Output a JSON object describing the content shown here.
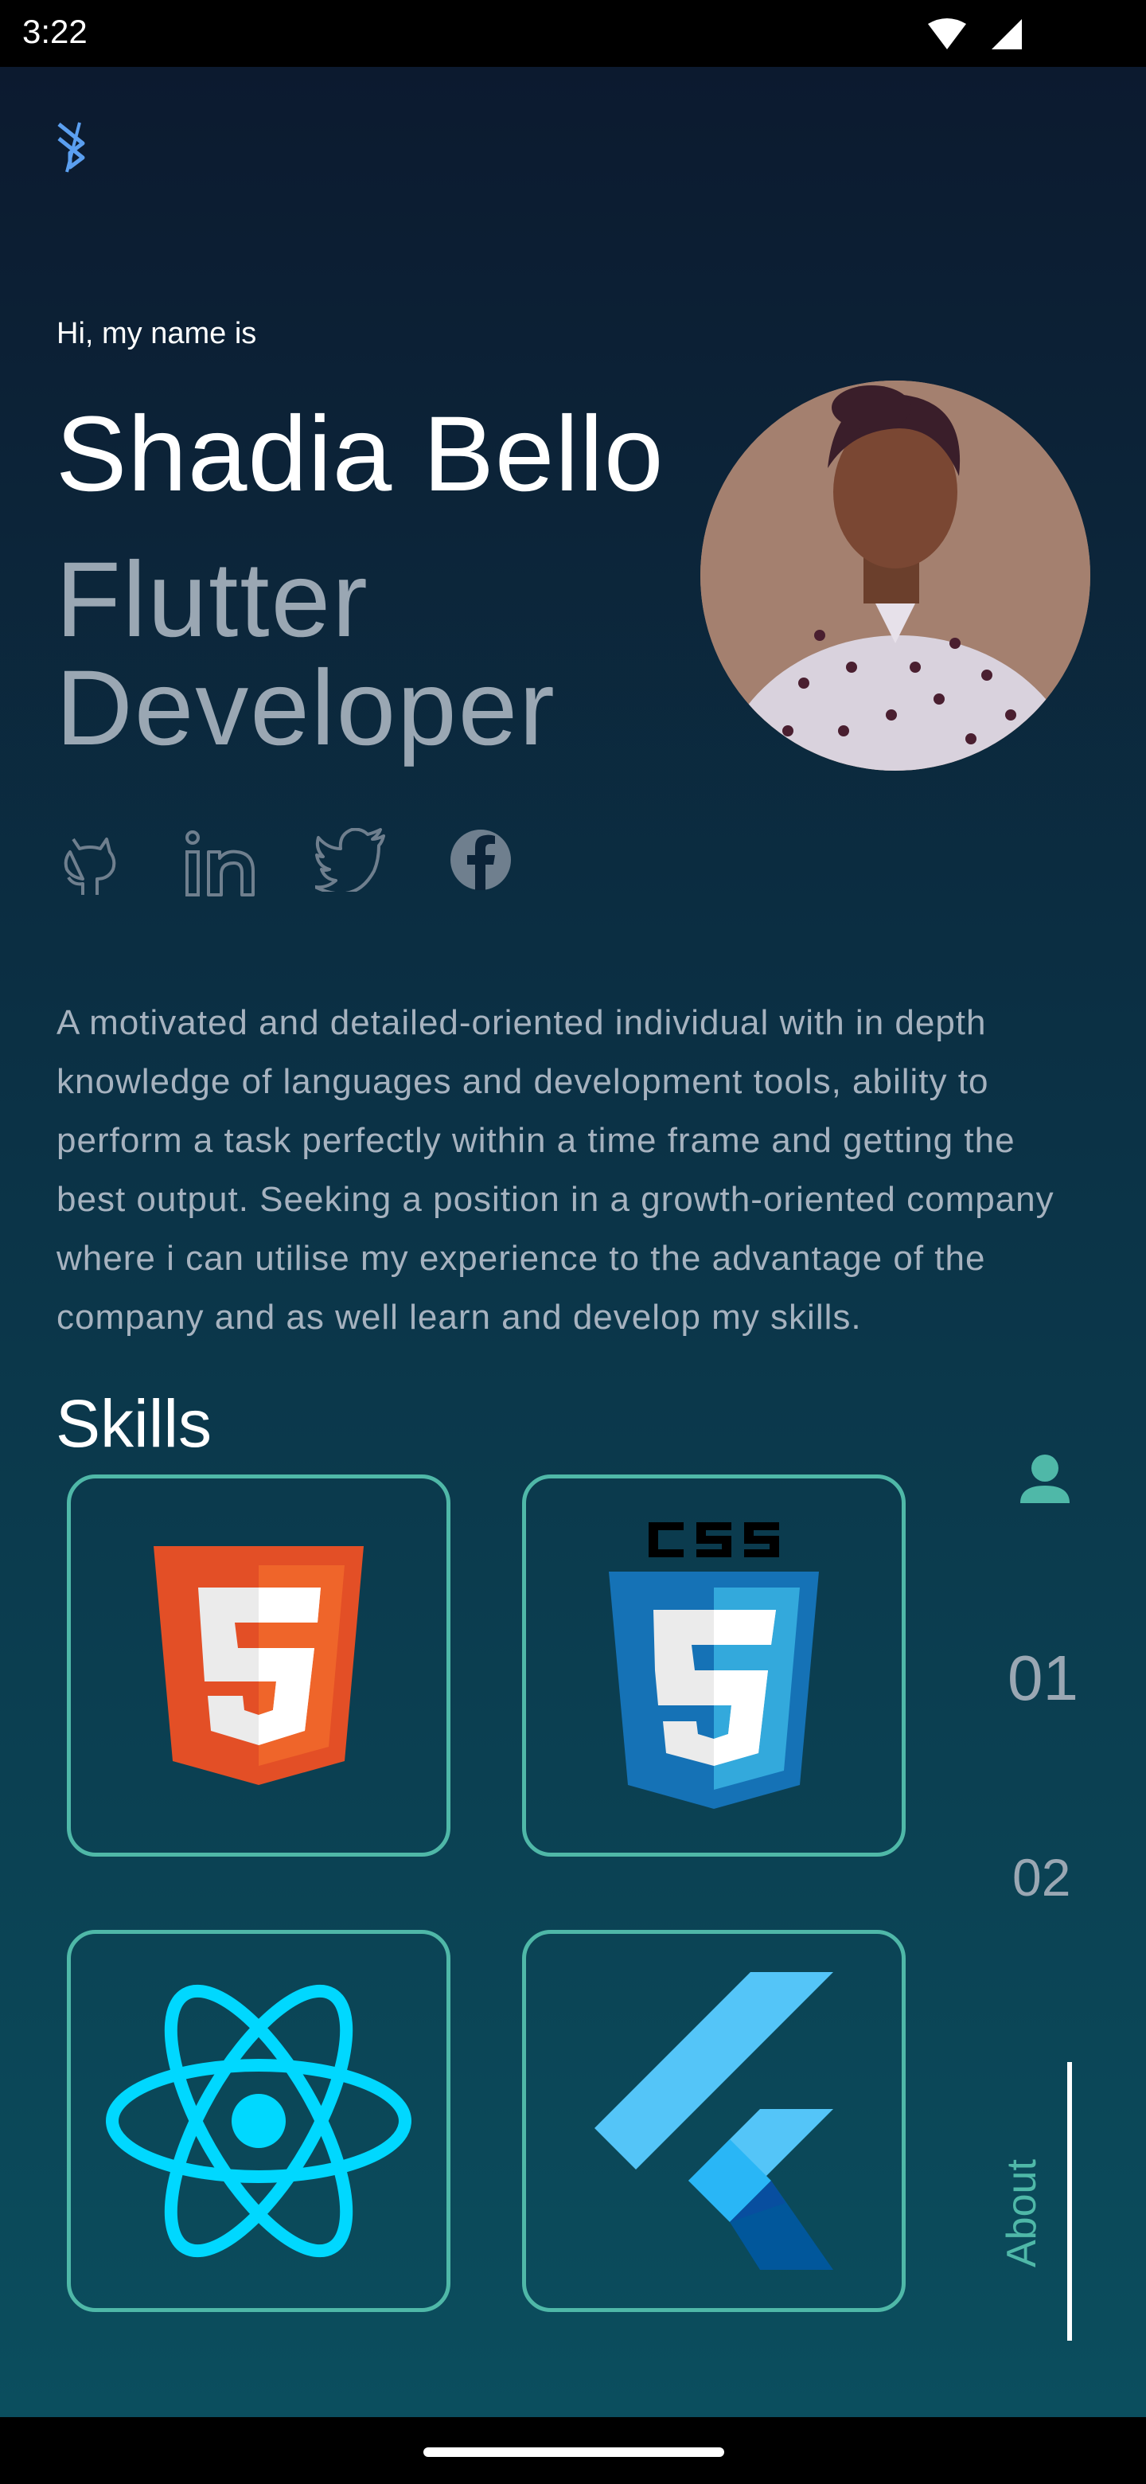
{
  "status_bar": {
    "time": "3:22",
    "icons": [
      "wifi-icon",
      "cellular-signal-icon"
    ]
  },
  "header": {
    "logo_icon": "app-logo-icon"
  },
  "hero": {
    "greeting": "Hi, my name is",
    "name": "Shadia Bello",
    "role": "Flutter Developer",
    "avatar": "profile-photo"
  },
  "socials": [
    {
      "name": "github",
      "icon": "github-icon"
    },
    {
      "name": "linkedin",
      "icon": "linkedin-icon"
    },
    {
      "name": "twitter",
      "icon": "twitter-icon"
    },
    {
      "name": "facebook",
      "icon": "facebook-icon"
    }
  ],
  "bio": "A motivated and detailed-oriented individual with in depth knowledge of  languages  and development tools, ability to perform a task perfectly within a time frame and getting the best output. Seeking a position in a growth-oriented company where i can utilise my experience to the advantage of the company and as well learn and develop my skills.",
  "skills": {
    "title": "Skills",
    "items": [
      {
        "name": "html5",
        "icon": "html5-icon"
      },
      {
        "name": "css3",
        "icon": "css3-icon",
        "badge": "CSS"
      },
      {
        "name": "react",
        "icon": "react-icon"
      },
      {
        "name": "flutter",
        "icon": "flutter-icon"
      }
    ]
  },
  "side_nav": {
    "person_icon": "person-icon",
    "item1": "01",
    "item2": "02",
    "active_label": "About"
  },
  "colors": {
    "accent": "#4fb8a8",
    "bg_top": "#0c1a2f",
    "bg_bottom": "#0b4e5e",
    "muted_text": "#9aa7b3"
  }
}
